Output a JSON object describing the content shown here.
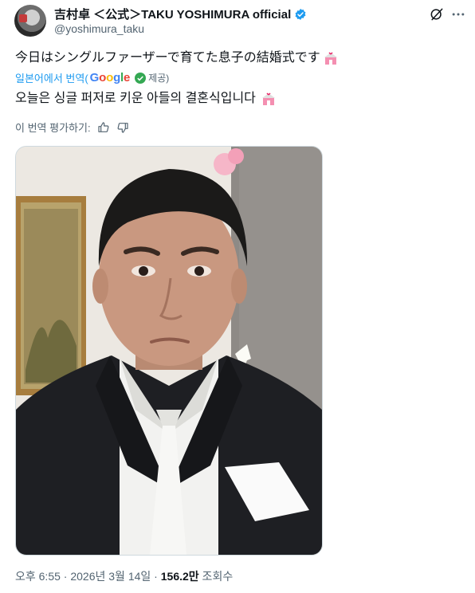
{
  "author": {
    "display_name": "吉村卓 ＜公式＞TAKU YOSHIMURA official",
    "handle": "@yoshimura_taku"
  },
  "icons": [
    "verified-badge-icon",
    "grok-icon",
    "more-icon",
    "chapel-emoji",
    "check-circle-icon",
    "thumbs-up-icon",
    "thumbs-down-icon"
  ],
  "tweet": {
    "original_text": "今日はシングルファーザーで育てた息子の結婚式です",
    "translate_label": "일본어에서 번역(",
    "google_letters": [
      "G",
      "o",
      "o",
      "g",
      "l",
      "e"
    ],
    "provided_label": "제공)",
    "translated_text": "오늘은 싱글 퍼저로 키운 아들의 결혼식입니다",
    "rate_label": "이 번역 평가하기:"
  },
  "meta": {
    "time": "오후 6:55",
    "sep1": " · ",
    "date": "2026년 3월 14일",
    "sep2": " · ",
    "views": "156.2만",
    "views_label": " 조회수"
  },
  "colors": {
    "accent": "#1d9bf0",
    "text": "#0f1419",
    "secondary": "#536471"
  }
}
